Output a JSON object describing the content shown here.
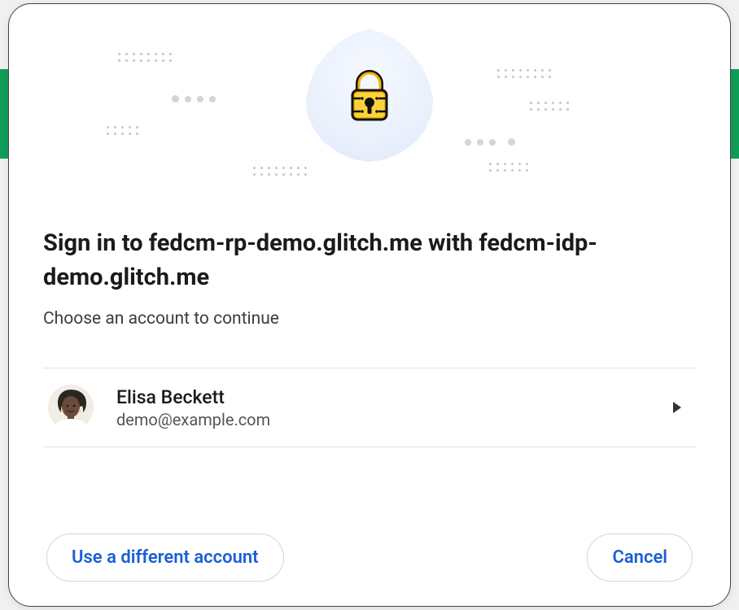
{
  "dialog": {
    "title": "Sign in to fedcm-rp-demo.glitch.me with fedcm-idp-demo.glitch.me",
    "subtitle": "Choose an account to continue"
  },
  "accounts": [
    {
      "name": "Elisa Beckett",
      "email": "demo@example.com"
    }
  ],
  "buttons": {
    "use_different": "Use a different account",
    "cancel": "Cancel"
  }
}
